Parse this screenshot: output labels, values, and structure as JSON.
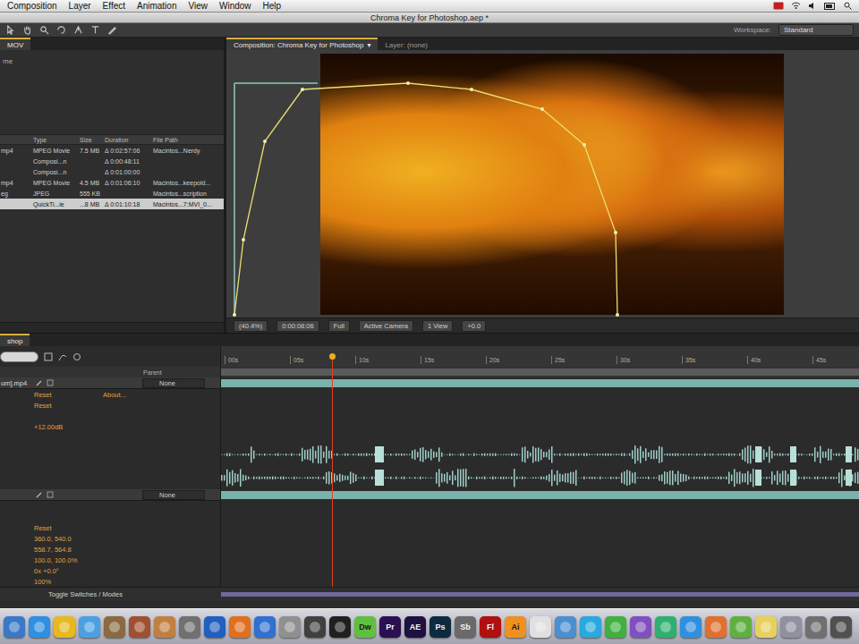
{
  "menu_bar": {
    "items": [
      "Composition",
      "Layer",
      "Effect",
      "Animation",
      "View",
      "Window",
      "Help"
    ]
  },
  "window": {
    "title": "Chroma Key for Photoshop.aep *"
  },
  "toolbar": {
    "workspace_label": "Workspace:",
    "workspace": "Standard"
  },
  "project_panel": {
    "tab": "MOV",
    "info": [
      "me"
    ],
    "columns": [
      "Type",
      "Size",
      "Duration",
      "File Path"
    ],
    "rows": [
      {
        "name": "mp4",
        "type": "MPEG Movie",
        "size": "7.5 MB",
        "duration": "Δ 0:02:57:06",
        "path": "Macintos...Nerdy",
        "selected": false
      },
      {
        "name": "",
        "type": "Composi...n",
        "size": "",
        "duration": "Δ 0:00:48:11",
        "path": "",
        "selected": false
      },
      {
        "name": "",
        "type": "Composi...n",
        "size": "",
        "duration": "Δ 0:01:00:00",
        "path": "",
        "selected": false
      },
      {
        "name": "mp4",
        "type": "MPEG Movie",
        "size": "4.5 MB",
        "duration": "Δ 0:01:06:10",
        "path": "Macintos...keepold...",
        "selected": false
      },
      {
        "name": "eg",
        "type": "JPEG",
        "size": "555 KB",
        "duration": "",
        "path": "Macintos...scription",
        "selected": false
      },
      {
        "name": "",
        "type": "QuickTi...ie",
        "size": "...8 MB",
        "duration": "Δ 0:01:10:18",
        "path": "Macintos...7:MVI_0...",
        "selected": true
      }
    ]
  },
  "viewer": {
    "tabs": [
      {
        "label": "Composition: Chroma Key for Photoshop",
        "glyph": "▾",
        "selected": true
      },
      {
        "label": "Layer: (none)",
        "glyph": "",
        "selected": false
      }
    ],
    "controls": [
      "(40.4%)",
      "0:00:08:06",
      "Full",
      "Active Camera",
      "1 View",
      "+0.0"
    ]
  },
  "timeline": {
    "tab": "shop",
    "columns": [
      "Parent"
    ],
    "ruler": [
      "00s",
      "05s",
      "10s",
      "15s",
      "20s",
      "25s",
      "30s",
      "35s",
      "40s",
      "45s"
    ],
    "playhead": {
      "level": 0.174
    },
    "rows": [
      {
        "kind": "layer",
        "name": "um].mp4",
        "parent": "None"
      },
      {
        "kind": "property",
        "value": "Reset",
        "extra": "About..."
      },
      {
        "kind": "property",
        "value": "Reset",
        "extra": ""
      },
      {
        "kind": "blank"
      },
      {
        "kind": "property",
        "value": "+12.00dB",
        "extra": ""
      },
      {
        "kind": "blank"
      },
      {
        "kind": "waveform"
      },
      {
        "kind": "waveform"
      },
      {
        "kind": "layer",
        "name": "",
        "parent": "None"
      },
      {
        "kind": "blank"
      },
      {
        "kind": "blank"
      },
      {
        "kind": "property",
        "value": "Reset",
        "extra": ""
      },
      {
        "kind": "property",
        "value": "360.0, 540.0",
        "extra": ""
      },
      {
        "kind": "property",
        "value": "558.7, 564.8",
        "extra": ""
      },
      {
        "kind": "property",
        "value": "100.0, 100.0%",
        "extra": ""
      },
      {
        "kind": "property",
        "value": "0x +0.0°",
        "extra": ""
      },
      {
        "kind": "property",
        "value": "100%",
        "extra": ""
      }
    ],
    "footer": "Toggle Switches / Modes"
  },
  "dock": {
    "items": [
      {
        "label": "",
        "color": "#3a78c8"
      },
      {
        "label": "",
        "color": "#2f8fe0"
      },
      {
        "label": "",
        "color": "#e8b820"
      },
      {
        "label": "",
        "color": "#4aa0e0"
      },
      {
        "label": "",
        "color": "#8a6a40"
      },
      {
        "label": "",
        "color": "#a05030"
      },
      {
        "label": "",
        "color": "#c08040"
      },
      {
        "label": "",
        "color": "#707070"
      },
      {
        "label": "",
        "color": "#2060c0"
      },
      {
        "label": "",
        "color": "#e07020"
      },
      {
        "label": "",
        "color": "#3070d0"
      },
      {
        "label": "",
        "color": "#909090"
      },
      {
        "label": "",
        "color": "#404040"
      },
      {
        "label": "",
        "color": "#202020"
      },
      {
        "label": "Dw",
        "color": "#5fbf3f"
      },
      {
        "label": "Pr",
        "color": "#2a1050"
      },
      {
        "label": "AE",
        "color": "#1e1040"
      },
      {
        "label": "Ps",
        "color": "#0e2a40"
      },
      {
        "label": "Sb",
        "color": "#6a6a6a"
      },
      {
        "label": "Fl",
        "color": "#b01010"
      },
      {
        "label": "Ai",
        "color": "#f09020"
      },
      {
        "label": "",
        "color": "#e0e0e0"
      },
      {
        "label": "",
        "color": "#4a90d0"
      },
      {
        "label": "",
        "color": "#2aa8e0"
      },
      {
        "label": "",
        "color": "#40b040"
      },
      {
        "label": "",
        "color": "#8050c0"
      },
      {
        "label": "",
        "color": "#30b070"
      },
      {
        "label": "",
        "color": "#3090e0"
      },
      {
        "label": "",
        "color": "#e07030"
      },
      {
        "label": "",
        "color": "#60b040"
      },
      {
        "label": "",
        "color": "#e8d060"
      },
      {
        "label": "",
        "color": "#9090a0"
      },
      {
        "label": "",
        "color": "#707070"
      },
      {
        "label": "",
        "color": "#505050"
      }
    ]
  }
}
